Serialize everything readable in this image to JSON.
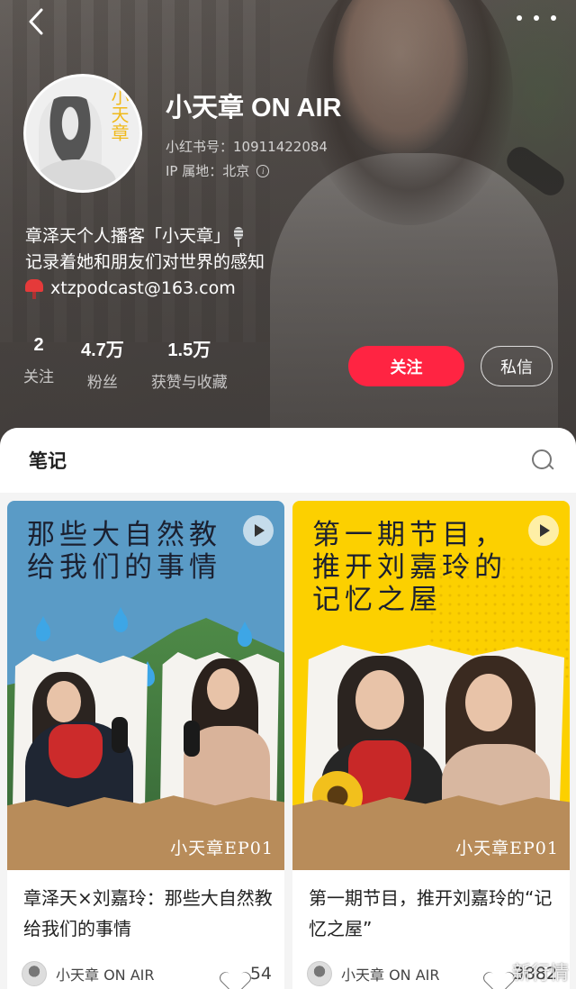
{
  "profile": {
    "name": "小天章 ON AIR",
    "red_id": "小红书号：10911422084",
    "ip_location": "IP 属地：北京",
    "avatar_glyphs": "小天章",
    "bio": [
      "章泽天个人播客「小天章」",
      "记录着她和朋友们对世界的感知",
      "xtzpodcast@163.com"
    ]
  },
  "stats": [
    {
      "value": "2",
      "label": "关注"
    },
    {
      "value": "4.7万",
      "label": "粉丝"
    },
    {
      "value": "1.5万",
      "label": "获赞与收藏"
    }
  ],
  "actions": {
    "follow": "关注",
    "message": "私信"
  },
  "notes_tab": {
    "label": "笔记"
  },
  "notes": [
    {
      "cover_title": "那些大自然教给我们的事情",
      "cover_color": "#5a9bc6",
      "episode_label": "小天章EP01",
      "title": "章泽天×刘嘉玲：那些大自然教给我们的事情",
      "author": "小天章 ON AIR",
      "likes": "54"
    },
    {
      "cover_title": "第一期节目，推开刘嘉玲的记忆之屋",
      "cover_color": "#fcd000",
      "episode_label": "小天章EP01",
      "title": "第一期节目，推开刘嘉玲的“记忆之屋”",
      "author": "小天章 ON AIR",
      "likes": "3882"
    }
  ],
  "watermark": "新行情",
  "colors": {
    "accent": "#ff2442"
  }
}
